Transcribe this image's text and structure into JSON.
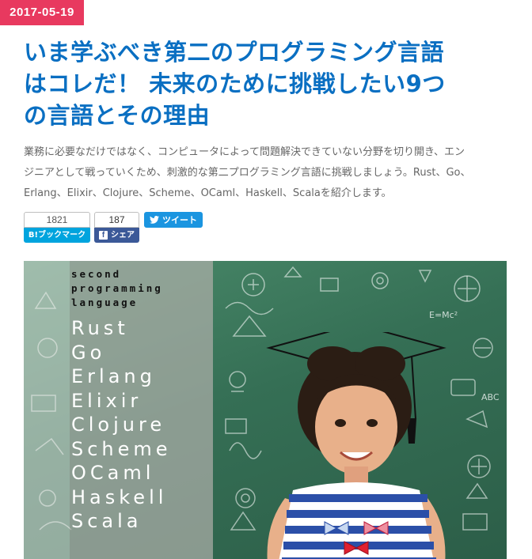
{
  "date": "2017-05-19",
  "title": {
    "line1": "いま学ぶべき第二のプログラミング言語",
    "line2": "はコレだ！ 未来のために挑戦したい9つ",
    "line3": "の言語とその理由"
  },
  "lead": {
    "line1": "業務に必要なだけではなく、コンピュータによって問題解決できていない分野を切り開き、エン",
    "line2": "ジニアとして戦っていくため、刺激的な第二プログラミング言語に挑戦しましょう。Rust、Go、",
    "line3": "Erlang、Elixir、Clojure、Scheme、OCaml、Haskell、Scalaを紹介します。"
  },
  "social": {
    "hatena_count": "1821",
    "hatena_label": "B!ブックマーク",
    "facebook_count": "187",
    "facebook_label": "シェア",
    "tweet_label": "ツイート"
  },
  "hero": {
    "subtitle": [
      "second",
      "programming",
      "language"
    ],
    "languages": [
      "Rust",
      "Go",
      "Erlang",
      "Elixir",
      "Clojure",
      "Scheme",
      "OCaml",
      "Haskell",
      "Scala"
    ],
    "doodle_text": [
      "E=Mc²",
      "ABC"
    ]
  }
}
